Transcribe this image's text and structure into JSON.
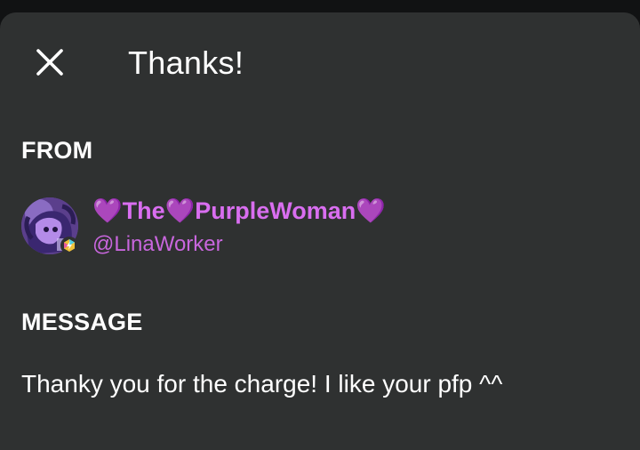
{
  "dialog": {
    "title": "Thanks!",
    "close_icon": "close-icon"
  },
  "from": {
    "label": "FROM",
    "display_name": "💜The💜PurpleWoman💜",
    "username": "@LinaWorker",
    "avatar_icon": "avatar",
    "badge_icon": "lightning-badge-icon"
  },
  "message": {
    "label": "MESSAGE",
    "text": "Thanky you for the charge! I like your pfp ^^"
  },
  "colors": {
    "sheet_background": "#2f3131",
    "name_color": "#d96ef0",
    "username_color": "#c866dd",
    "text_color": "#ffffff"
  }
}
